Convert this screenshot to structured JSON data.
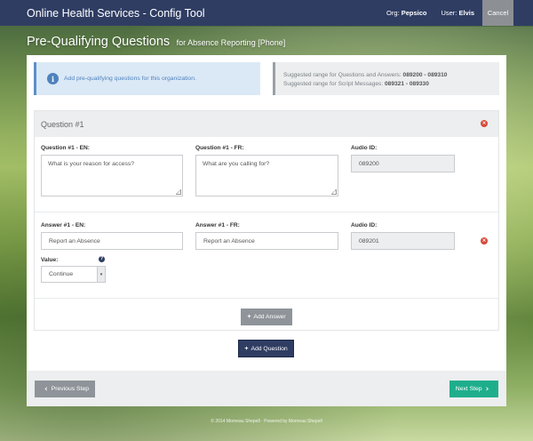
{
  "header": {
    "app_title": "Online Health Services - Config Tool",
    "org_label": "Org:",
    "org_value": "Pepsico",
    "user_label": "User:",
    "user_value": "Elvis",
    "cancel_label": "Cancel"
  },
  "page": {
    "title": "Pre-Qualifying Questions",
    "subtitle": "for Absence Reporting [Phone]"
  },
  "info": {
    "icon": "info-icon",
    "text": "Add pre-qualifying questions for this organization."
  },
  "ranges": {
    "qa_label": "Suggested range for Questions and Answers:",
    "qa_value": "089200 - 089310",
    "script_label": "Suggested range for Script Messages:",
    "script_value": "089321 - 089330"
  },
  "question": {
    "heading": "Question #1",
    "en_label": "Question #1 - EN:",
    "en_value": "What is your reason for access?",
    "fr_label": "Question #1 - FR:",
    "fr_value": "What are you calling for?",
    "audio_label": "Audio ID:",
    "audio_value": "089200"
  },
  "answer": {
    "en_label": "Answer #1 - EN:",
    "en_value": "Report an Absence",
    "fr_label": "Answer #1 - FR:",
    "fr_value": "Report an Absence",
    "audio_label": "Audio ID:",
    "audio_value": "089201",
    "value_label": "Value:",
    "value_selected": "Continue"
  },
  "buttons": {
    "add_answer": "Add Answer",
    "add_question": "Add Question",
    "previous": "Previous Step",
    "next": "Next Step"
  },
  "footer": {
    "text": "© 2014 Morneau Shepell  ·  Powered by Morneau Shepell"
  },
  "colors": {
    "navy": "#2f3d63",
    "teal": "#1fae8c",
    "danger": "#d64a3a",
    "info": "#4f82bd"
  }
}
